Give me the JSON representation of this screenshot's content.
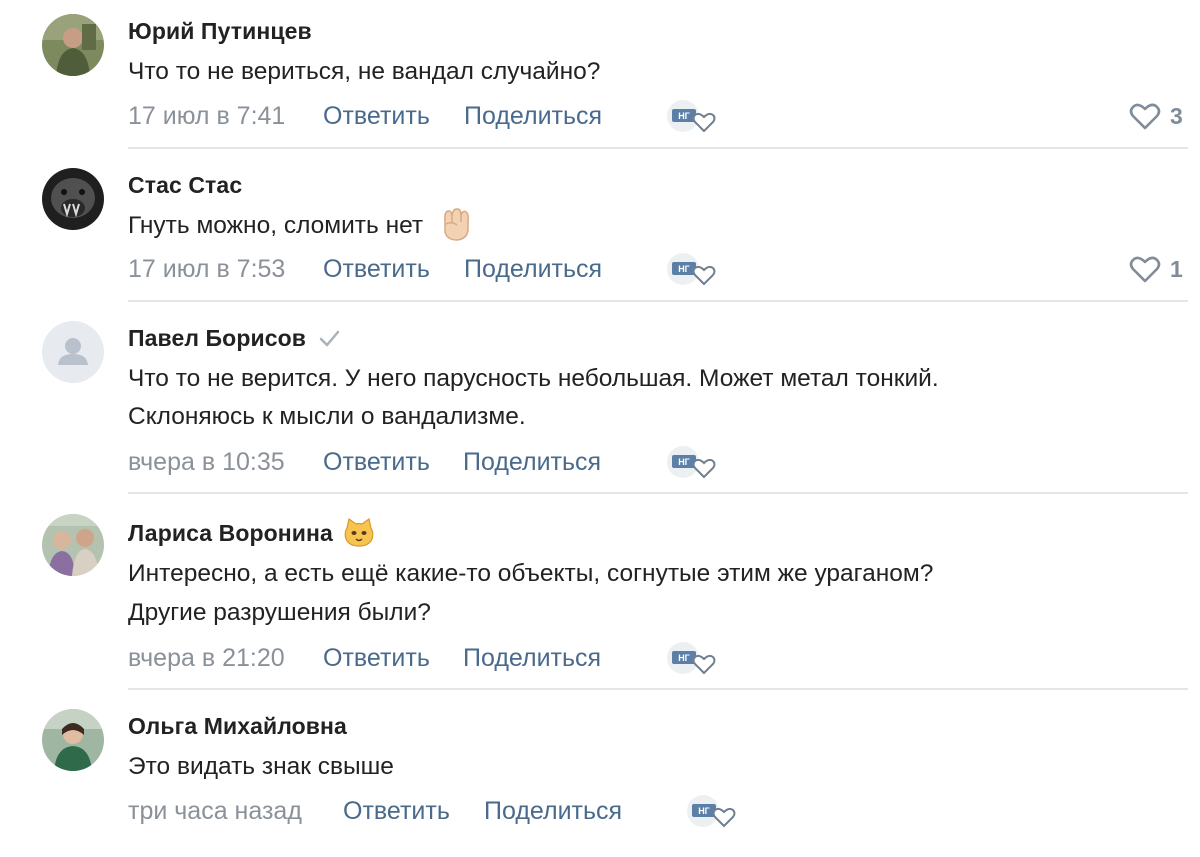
{
  "comments": [
    {
      "author": "Юрий Путинцев",
      "lines": [
        "Что то не вериться, не вандал случайно?"
      ],
      "date": "17 июл в 7:41",
      "reply_label": "Ответить",
      "share_label": "Поделиться",
      "likes": "3"
    },
    {
      "author": "Стас Стас",
      "lines": [
        "Гнуть можно, сломить нет"
      ],
      "date": "17 июл в 7:53",
      "reply_label": "Ответить",
      "share_label": "Поделиться",
      "likes": "1"
    },
    {
      "author": "Павел Борисов",
      "lines": [
        "Что то не верится. У него парусность небольшая. Может метал тонкий.",
        "Склоняюсь к мысли о вандализме."
      ],
      "date": "вчера в 10:35",
      "reply_label": "Ответить",
      "share_label": "Поделиться"
    },
    {
      "author": "Лариса Воронина",
      "lines": [
        "Интересно, а есть ещё какие-то объекты, согнутые этим же ураганом?",
        "Другие разрушения были?"
      ],
      "date": "вчера в 21:20",
      "reply_label": "Ответить",
      "share_label": "Поделиться"
    },
    {
      "author": "Ольга Михайловна",
      "lines": [
        "Это видать знак свыше"
      ],
      "date": "три часа назад",
      "reply_label": "Ответить",
      "share_label": "Поделиться"
    }
  ],
  "icons": {
    "verified": "check-icon",
    "author_badge": "cat-face-emoji-icon",
    "text_emoji": "raised-fist-emoji-icon",
    "reaction": "sticker-reaction-icon",
    "like": "heart-icon"
  },
  "colors": {
    "author_text": "#222222",
    "body_text": "#222222",
    "date_text": "#8a9199",
    "link_text": "#4a6a8c",
    "like_text": "#818c99",
    "divider": "#e3e5e8"
  }
}
